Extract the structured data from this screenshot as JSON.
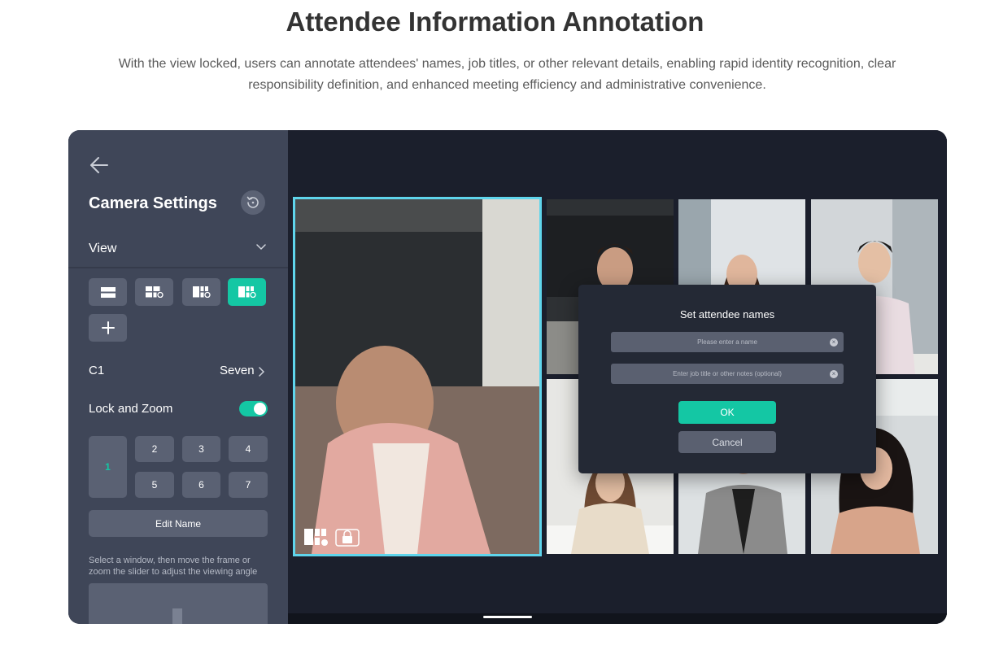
{
  "page": {
    "title": "Attendee Information Annotation",
    "description": "With the view locked, users can annotate attendees' names, job titles, or other relevant details, enabling rapid identity recognition, clear responsibility definition, and enhanced meeting efficiency and administrative convenience."
  },
  "sidebar": {
    "title": "Camera Settings",
    "back_icon": "arrow-left-icon",
    "reset_icon": "reset-icon",
    "view_label": "View",
    "layouts": [
      {
        "name": "single-layout",
        "active": false
      },
      {
        "name": "grid-2-layout",
        "active": false
      },
      {
        "name": "grid-3-layout",
        "active": false
      },
      {
        "name": "grid-6-layout",
        "active": true
      }
    ],
    "add_icon": "plus-icon",
    "camera_label": "C1",
    "camera_value": "Seven",
    "lock_zoom_label": "Lock and Zoom",
    "lock_zoom_on": true,
    "windows": [
      "1",
      "2",
      "3",
      "4",
      "5",
      "6",
      "7"
    ],
    "selected_window": "1",
    "edit_name_label": "Edit Name",
    "hint": "Select a window, then move the frame or zoom the slider to adjust the viewing angle"
  },
  "dialog": {
    "title": "Set attendee names",
    "name_placeholder": "Please enter a name",
    "notes_placeholder": "Enter job title or other notes (optional)",
    "ok_label": "OK",
    "cancel_label": "Cancel"
  },
  "colors": {
    "accent": "#14c7a4",
    "selection": "#5fd5ec",
    "sidebar_bg": "#3f4658",
    "dialog_bg": "#242935"
  }
}
